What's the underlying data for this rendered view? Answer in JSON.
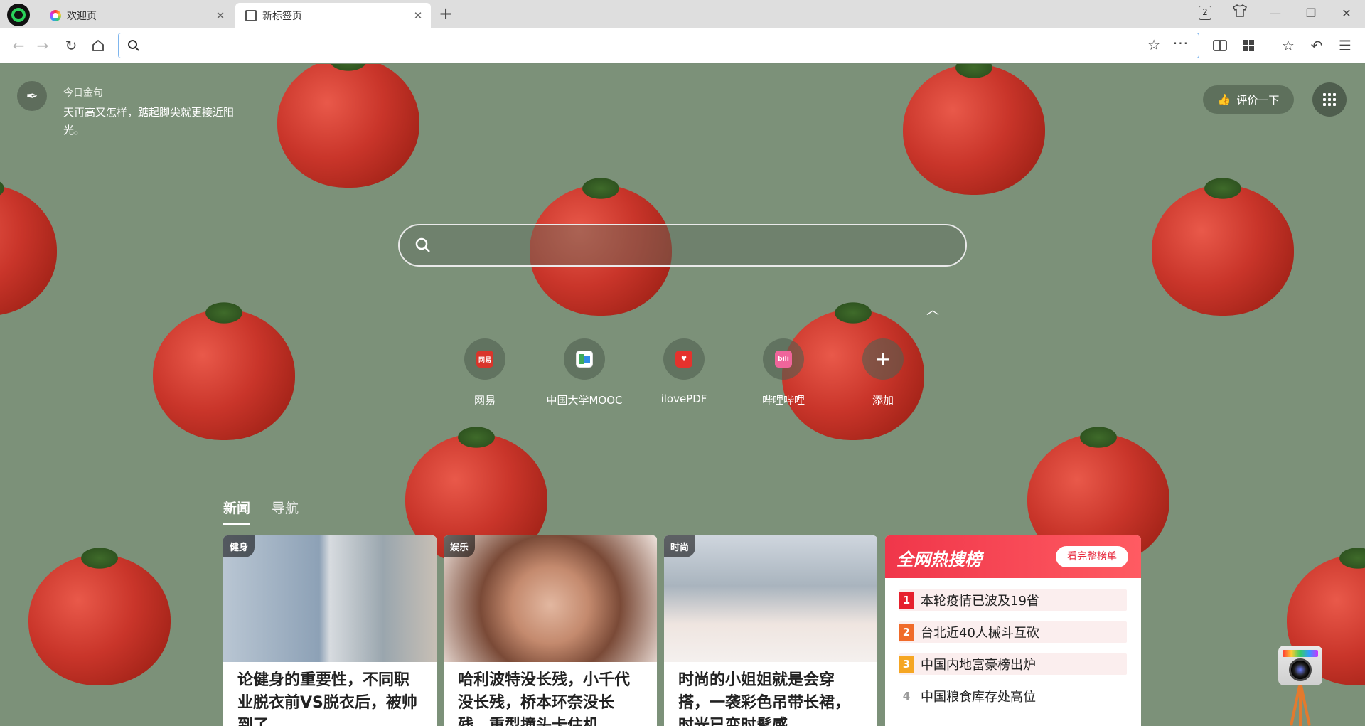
{
  "tabs": [
    {
      "label": "欢迎页",
      "icon": "rainbow-logo-icon"
    },
    {
      "label": "新标签页",
      "icon": "page-icon"
    }
  ],
  "window": {
    "tab_count": "2"
  },
  "toolbar": {
    "address_value": "",
    "address_placeholder": ""
  },
  "quote": {
    "label": "今日金句",
    "text": "天再高又怎样，踮起脚尖就更接近阳光。"
  },
  "rate_button": {
    "label": "评价一下"
  },
  "search": {
    "placeholder": ""
  },
  "shortcuts": [
    {
      "name": "网易",
      "icon_text": "网易",
      "color": "#d9352b"
    },
    {
      "name": "中国大学MOOC",
      "icon_text": "",
      "color": "#3ea85b"
    },
    {
      "name": "ilovePDF",
      "icon_text": "",
      "color": "#e5322d"
    },
    {
      "name": "哔哩哔哩",
      "icon_text": "bili",
      "color": "#f0659b"
    },
    {
      "name": "添加",
      "icon_text": "+",
      "color": "transparent"
    }
  ],
  "news_tabs": [
    {
      "label": "新闻",
      "active": true
    },
    {
      "label": "导航",
      "active": false
    }
  ],
  "news_cards": [
    {
      "tag": "健身",
      "title": "论健身的重要性，不同职业脱衣前VS脱衣后，被帅到了"
    },
    {
      "tag": "娱乐",
      "title": "哈利波特没长残，小千代没长残，桥本环奈没长残，重型撞头卡住机"
    },
    {
      "tag": "时尚",
      "title": "时尚的小姐姐就是会穿搭，一袭彩色吊带长裙，时光已变时髦感"
    }
  ],
  "hot_list": {
    "title": "全网热搜榜",
    "button": "看完整榜单",
    "items": [
      {
        "rank": "1",
        "text": "本轮疫情已波及19省"
      },
      {
        "rank": "2",
        "text": "台北近40人械斗互砍"
      },
      {
        "rank": "3",
        "text": "中国内地富豪榜出炉"
      },
      {
        "rank": "4",
        "text": "中国粮食库存处高位"
      }
    ]
  },
  "colors": {
    "accent": "#2ad15a",
    "hot_red": "#f0364a",
    "address_border": "#7fb6ee"
  }
}
